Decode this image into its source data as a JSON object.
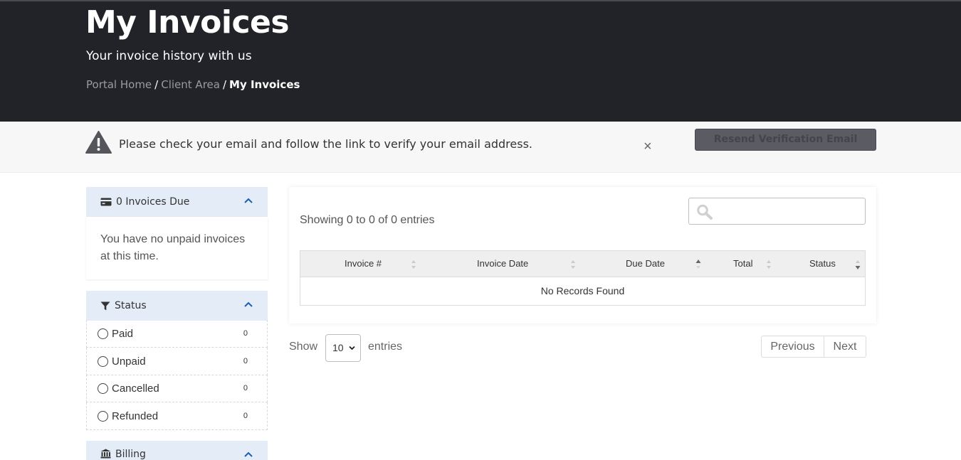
{
  "header": {
    "title": "My Invoices",
    "subtitle": "Your invoice history with us",
    "breadcrumb": [
      {
        "label": "Portal Home"
      },
      {
        "label": "Client Area"
      },
      {
        "label": "My Invoices"
      }
    ],
    "separator": "/"
  },
  "alert": {
    "icon": "warning-icon",
    "message": "Please check your email and follow the link to verify your email address.",
    "close": "×",
    "button_label": "Resend Verification Email"
  },
  "sidebar": {
    "invoices_due": {
      "icon": "credit-card-icon",
      "title": "0 Invoices Due",
      "message": "You have no unpaid invoices at this time."
    },
    "status": {
      "icon": "filter-icon",
      "title": "Status",
      "items": [
        {
          "label": "Paid",
          "count": "0"
        },
        {
          "label": "Unpaid",
          "count": "0"
        },
        {
          "label": "Cancelled",
          "count": "0"
        },
        {
          "label": "Refunded",
          "count": "0"
        }
      ]
    },
    "billing": {
      "icon": "bank-icon",
      "title": "Billing"
    }
  },
  "table": {
    "info": "Showing 0 to 0 of 0 entries",
    "search_placeholder": "",
    "columns": [
      "Invoice #",
      "Invoice Date",
      "Due Date",
      "Total",
      "Status"
    ],
    "empty_message": "No Records Found",
    "sorted_column": "Due Date",
    "sort_direction": "ascending"
  },
  "footer": {
    "show_label": "Show",
    "page_size": "10",
    "entries_label": "entries",
    "previous": "Previous",
    "next": "Next"
  }
}
